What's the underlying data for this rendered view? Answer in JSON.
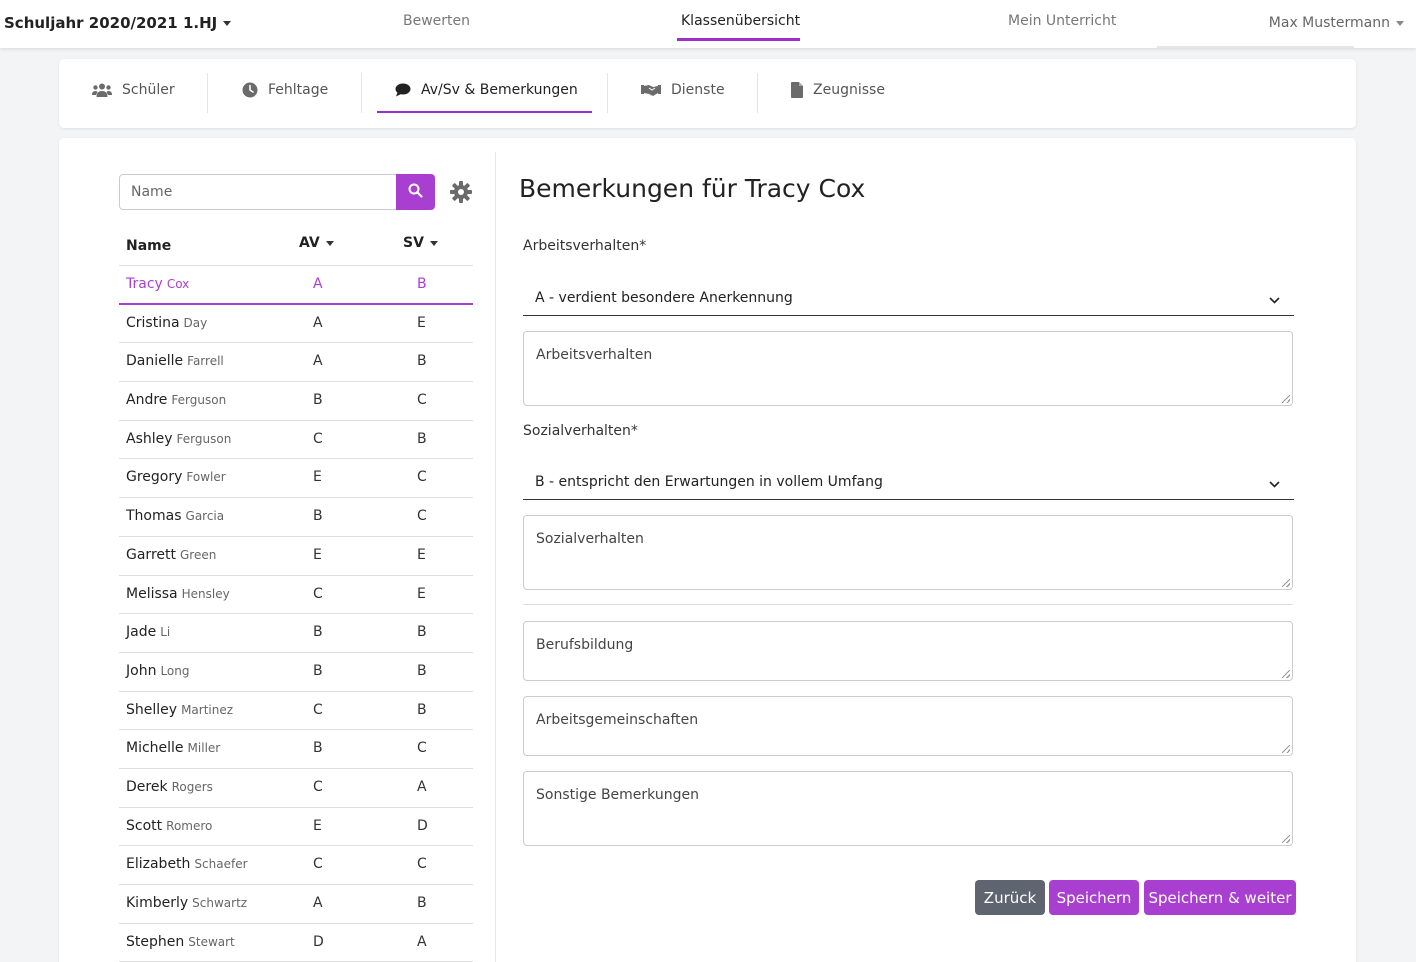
{
  "header": {
    "school_year": "Schuljahr 2020/2021 1.HJ",
    "nav": [
      {
        "label": "Bewerten"
      },
      {
        "label": "Klassenübersicht"
      },
      {
        "label": "Mein Unterricht"
      }
    ],
    "user": "Max Mustermann"
  },
  "tabs": [
    {
      "label": "Schüler",
      "icon": "users-icon"
    },
    {
      "label": "Fehltage",
      "icon": "clock-icon"
    },
    {
      "label": "Av/Sv & Bemerkungen",
      "icon": "comment-icon"
    },
    {
      "label": "Dienste",
      "icon": "handshake-icon"
    },
    {
      "label": "Zeugnisse",
      "icon": "file-icon"
    }
  ],
  "search": {
    "placeholder": "Name"
  },
  "table": {
    "headers": {
      "name": "Name",
      "av": "AV",
      "sv": "SV"
    },
    "rows": [
      {
        "first": "Tracy",
        "last": "Cox",
        "av": "A",
        "sv": "B"
      },
      {
        "first": "Cristina",
        "last": "Day",
        "av": "A",
        "sv": "E"
      },
      {
        "first": "Danielle",
        "last": "Farrell",
        "av": "A",
        "sv": "B"
      },
      {
        "first": "Andre",
        "last": "Ferguson",
        "av": "B",
        "sv": "C"
      },
      {
        "first": "Ashley",
        "last": "Ferguson",
        "av": "C",
        "sv": "B"
      },
      {
        "first": "Gregory",
        "last": "Fowler",
        "av": "E",
        "sv": "C"
      },
      {
        "first": "Thomas",
        "last": "Garcia",
        "av": "B",
        "sv": "C"
      },
      {
        "first": "Garrett",
        "last": "Green",
        "av": "E",
        "sv": "E"
      },
      {
        "first": "Melissa",
        "last": "Hensley",
        "av": "C",
        "sv": "E"
      },
      {
        "first": "Jade",
        "last": "Li",
        "av": "B",
        "sv": "B"
      },
      {
        "first": "John",
        "last": "Long",
        "av": "B",
        "sv": "B"
      },
      {
        "first": "Shelley",
        "last": "Martinez",
        "av": "C",
        "sv": "B"
      },
      {
        "first": "Michelle",
        "last": "Miller",
        "av": "B",
        "sv": "C"
      },
      {
        "first": "Derek",
        "last": "Rogers",
        "av": "C",
        "sv": "A"
      },
      {
        "first": "Scott",
        "last": "Romero",
        "av": "E",
        "sv": "D"
      },
      {
        "first": "Elizabeth",
        "last": "Schaefer",
        "av": "C",
        "sv": "C"
      },
      {
        "first": "Kimberly",
        "last": "Schwartz",
        "av": "A",
        "sv": "B"
      },
      {
        "first": "Stephen",
        "last": "Stewart",
        "av": "D",
        "sv": "A"
      }
    ]
  },
  "form": {
    "title": "Bemerkungen für Tracy Cox",
    "av_label": "Arbeitsverhalten*",
    "av_value": "A - verdient besondere Anerkennung",
    "av_text": "Arbeitsverhalten",
    "sv_label": "Sozialverhalten*",
    "sv_value": "B - entspricht den Erwartungen in vollem Umfang",
    "sv_text": "Sozialverhalten",
    "berufsbildung": "Berufsbildung",
    "arbeitsgemeinschaften": "Arbeitsgemeinschaften",
    "sonstige": "Sonstige Bemerkungen"
  },
  "buttons": {
    "back": "Zurück",
    "save": "Speichern",
    "save_next": "Speichern & weiter"
  },
  "colors": {
    "accent": "#a93fd0",
    "secondary": "#5e6470"
  }
}
